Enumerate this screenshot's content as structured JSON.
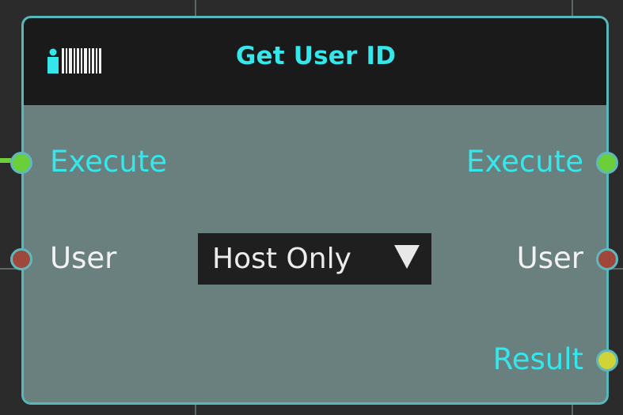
{
  "node": {
    "title": "Get User ID",
    "icon": "user-barcode-icon"
  },
  "inputs": [
    {
      "label": "Execute",
      "pin_type": "exec",
      "pin_color": "#6bcf39",
      "label_color": "#35e6ea"
    },
    {
      "label": "User",
      "pin_type": "user",
      "pin_color": "#a0473c",
      "label_color": "#f2f2f2"
    }
  ],
  "outputs": [
    {
      "label": "Execute",
      "pin_type": "exec",
      "pin_color": "#6bcf39",
      "label_color": "#35e6ea"
    },
    {
      "label": "User",
      "pin_type": "user",
      "pin_color": "#a0473c",
      "label_color": "#f2f2f2"
    },
    {
      "label": "Result",
      "pin_type": "result",
      "pin_color": "#d2d336",
      "label_color": "#35e6ea"
    }
  ],
  "dropdown": {
    "selected": "Host Only",
    "icon": "triangle-down-icon"
  },
  "colors": {
    "node_border": "#57b7bb",
    "node_body": "#6a807f",
    "header_bg": "#1a1a1a",
    "title": "#35e6ea",
    "canvas_bg": "#2b2b2b"
  }
}
